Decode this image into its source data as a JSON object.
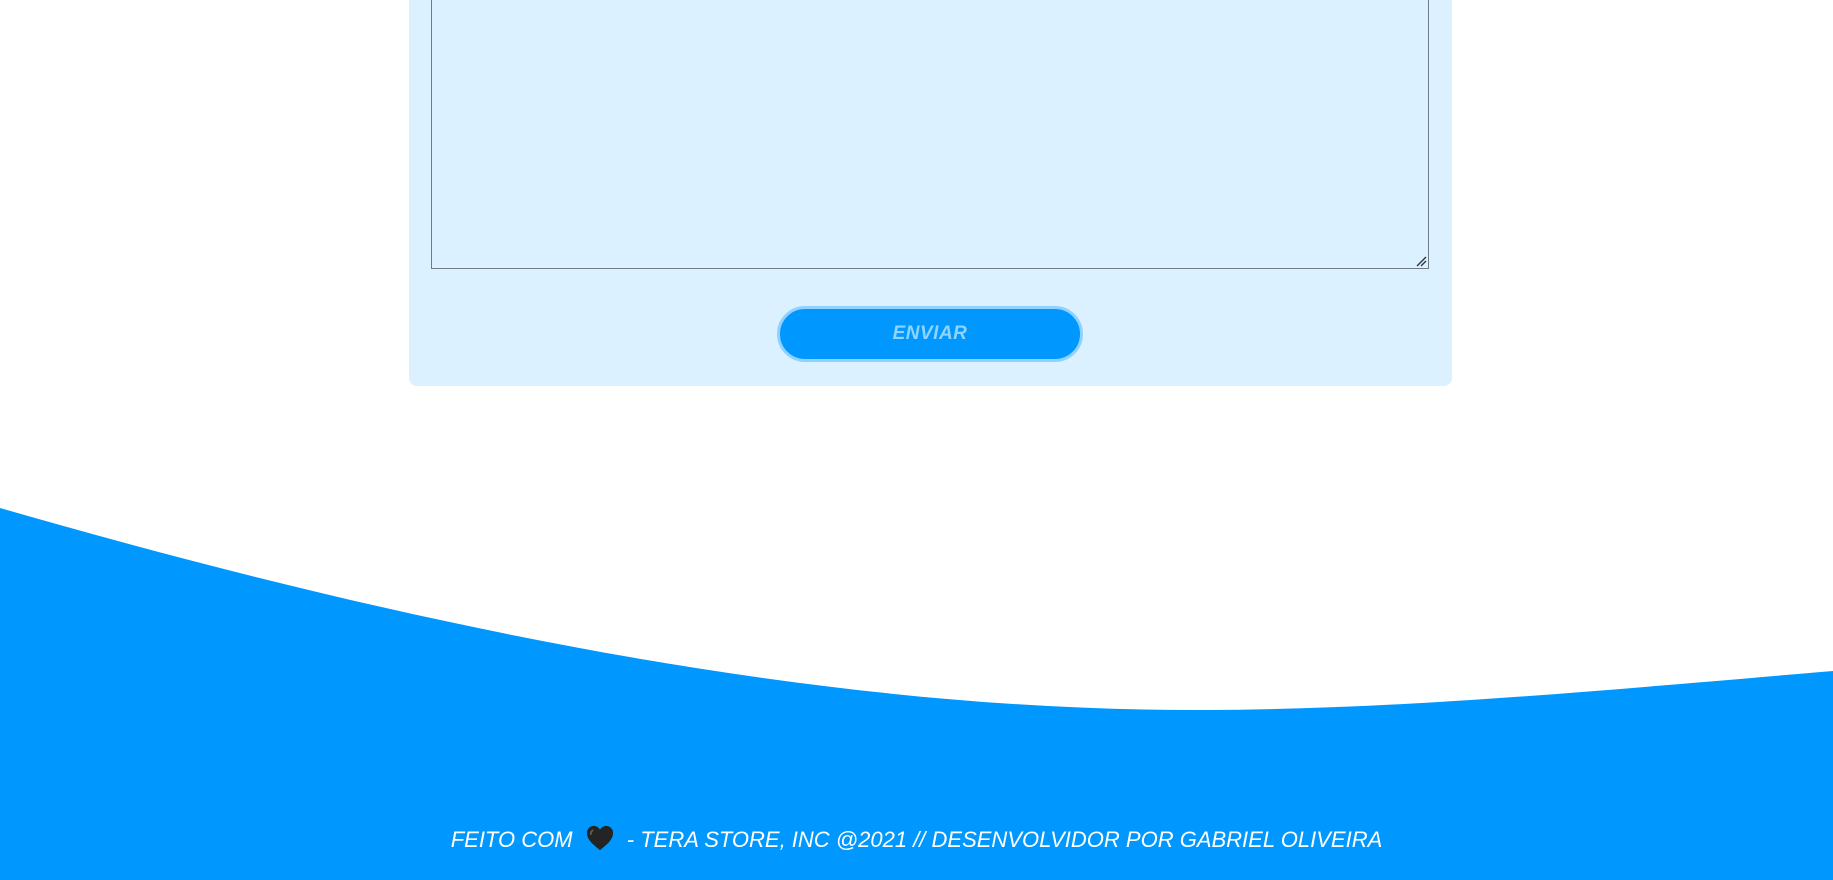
{
  "contact_form": {
    "message_value": "",
    "submit_label": "ENVIAR"
  },
  "footer": {
    "prefix": "FEITO COM",
    "heart_icon": "heart-icon",
    "suffix": "- TERA STORE, INC @2021 // DESENVOLVIDOR POR GABRIEL OLIVEIRA"
  },
  "colors": {
    "accent": "#0098ff",
    "form_background": "#dbf1ff",
    "button_text": "#8ed4ff",
    "footer_text": "#ffffff"
  }
}
